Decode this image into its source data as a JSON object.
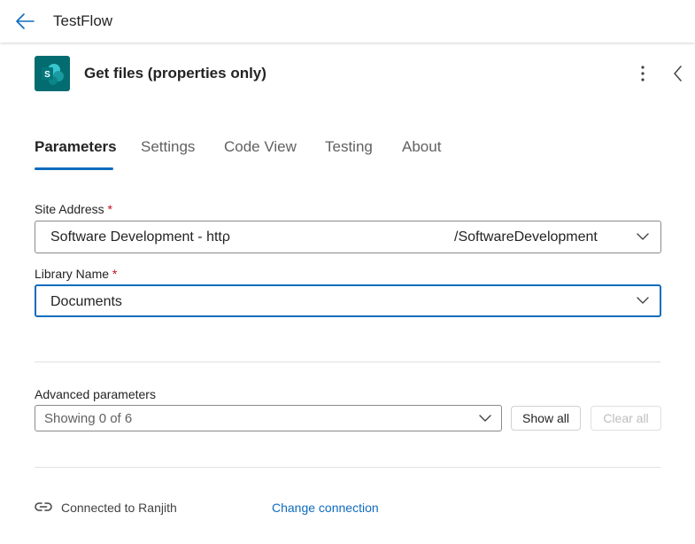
{
  "header": {
    "back_icon": "arrow-left-icon",
    "flow_name": "TestFlow"
  },
  "action": {
    "icon": "sharepoint-icon",
    "icon_color": "#036c70",
    "title": "Get files (properties only)",
    "more_icon": "more-vertical-icon",
    "collapse_icon": "chevron-left-icon"
  },
  "tabs": [
    {
      "label": "Parameters",
      "active": true
    },
    {
      "label": "Settings"
    },
    {
      "label": "Code View"
    },
    {
      "label": "Testing"
    },
    {
      "label": "About"
    }
  ],
  "fields": {
    "site_address": {
      "label": "Site Address",
      "required_mark": "*",
      "value_start": "Software Development - httρ",
      "value_end": "/SoftwareDevelopment"
    },
    "library_name": {
      "label": "Library Name",
      "required_mark": "*",
      "value": "Documents"
    }
  },
  "advanced": {
    "label": "Advanced parameters",
    "summary": "Showing 0 of 6",
    "show_all": "Show all",
    "clear_all": "Clear all"
  },
  "connection": {
    "icon": "link-icon",
    "text": "Connected to Ranjith",
    "change_label": "Change connection"
  },
  "colors": {
    "accent": "#0f6cbd",
    "required": "#c50f1f"
  }
}
